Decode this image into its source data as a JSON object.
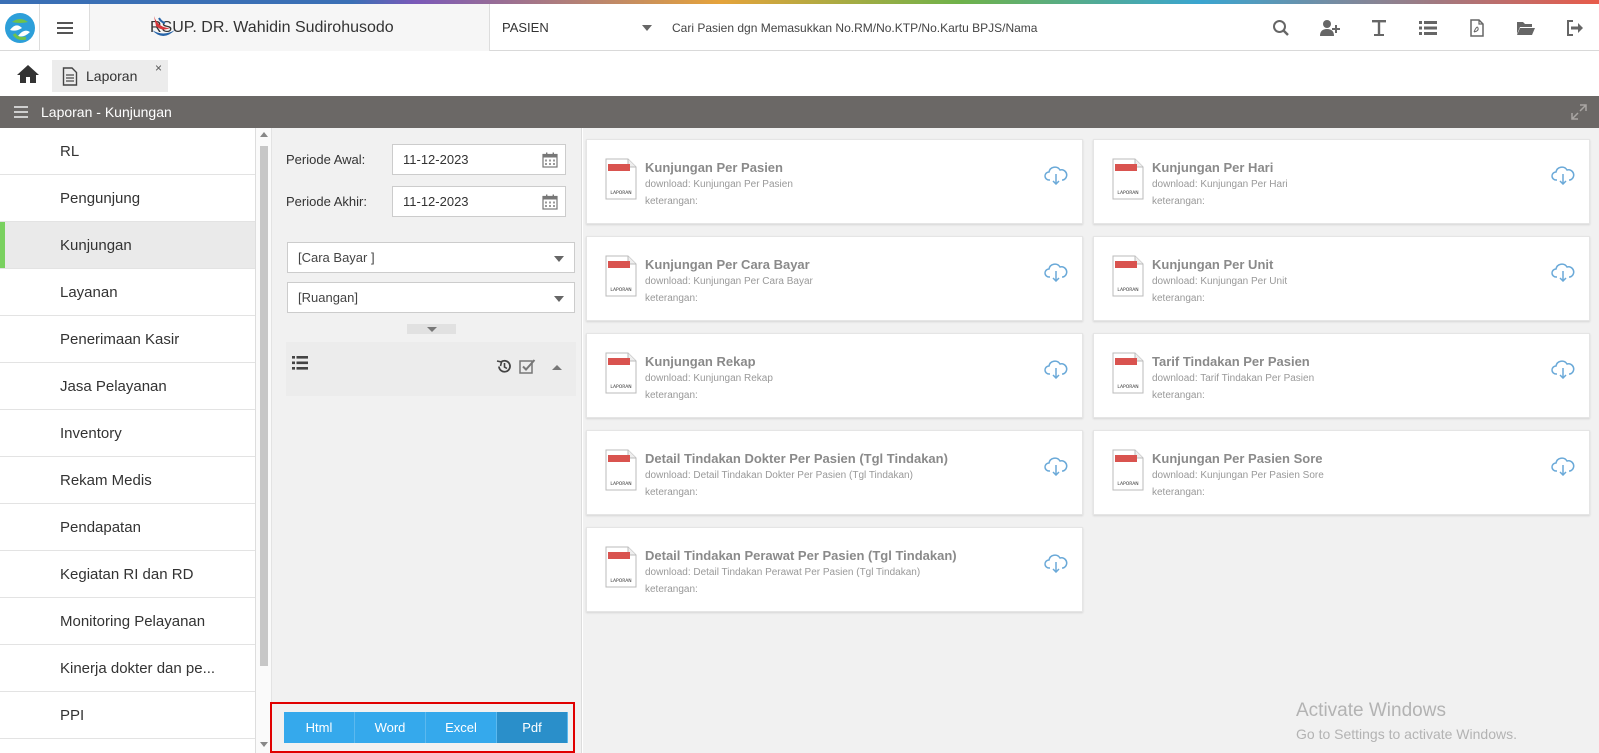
{
  "header": {
    "hospital_name": "RSUP. DR. Wahidin Sudirohusodo",
    "search_category": "PASIEN",
    "search_placeholder": "Cari Pasien dgn Memasukkan No.RM/No.KTP/No.Kartu BPJS/Nama",
    "icons": [
      "search-icon",
      "add-user-icon",
      "text-icon",
      "list-icon",
      "pdf-icon",
      "folder-open-icon",
      "logout-icon"
    ]
  },
  "tabs": [
    {
      "label": "Laporan",
      "close": "×"
    }
  ],
  "section": {
    "title": "Laporan - Kunjungan"
  },
  "sidebar": {
    "items": [
      {
        "label": "RL"
      },
      {
        "label": "Pengunjung"
      },
      {
        "label": "Kunjungan",
        "active": true
      },
      {
        "label": "Layanan"
      },
      {
        "label": "Penerimaan Kasir"
      },
      {
        "label": "Jasa Pelayanan"
      },
      {
        "label": "Inventory"
      },
      {
        "label": "Rekam Medis"
      },
      {
        "label": "Pendapatan"
      },
      {
        "label": "Kegiatan RI dan RD"
      },
      {
        "label": "Monitoring Pelayanan"
      },
      {
        "label": "Kinerja dokter dan pe..."
      },
      {
        "label": "PPI"
      }
    ]
  },
  "filters": {
    "periode_awal_label": "Periode Awal:",
    "periode_awal_value": "11-12-2023",
    "periode_akhir_label": "Periode Akhir:",
    "periode_akhir_value": "11-12-2023",
    "cara_bayar": "[Cara Bayar ]",
    "ruangan": "[Ruangan]"
  },
  "formats": [
    {
      "label": "Html"
    },
    {
      "label": "Word"
    },
    {
      "label": "Excel"
    },
    {
      "label": "Pdf",
      "active": true
    }
  ],
  "reports": [
    {
      "title": "Kunjungan Per Pasien",
      "download": "download: Kunjungan Per Pasien",
      "keterangan": "keterangan:"
    },
    {
      "title": "Kunjungan Per Hari",
      "download": "download: Kunjungan Per Hari",
      "keterangan": "keterangan:"
    },
    {
      "title": "Kunjungan Per Cara Bayar",
      "download": "download: Kunjungan Per Cara Bayar",
      "keterangan": "keterangan:"
    },
    {
      "title": "Kunjungan Per Unit",
      "download": "download: Kunjungan Per Unit",
      "keterangan": "keterangan:"
    },
    {
      "title": "Kunjungan Rekap",
      "download": "download: Kunjungan Rekap",
      "keterangan": "keterangan:"
    },
    {
      "title": "Tarif Tindakan Per Pasien",
      "download": "download: Tarif Tindakan Per Pasien",
      "keterangan": "keterangan:"
    },
    {
      "title": "Detail Tindakan Dokter Per Pasien (Tgl Tindakan)",
      "download": "download: Detail Tindakan Dokter Per Pasien (Tgl Tindakan)",
      "keterangan": "keterangan:"
    },
    {
      "title": "Kunjungan Per Pasien Sore",
      "download": "download: Kunjungan Per Pasien Sore",
      "keterangan": "keterangan:"
    },
    {
      "title": "Detail Tindakan Perawat Per Pasien (Tgl Tindakan)",
      "download": "download: Detail Tindakan Perawat Per Pasien (Tgl Tindakan)",
      "keterangan": "keterangan:"
    }
  ],
  "doc_icon_label": "LAPORAN",
  "watermark": {
    "line1": "Activate Windows",
    "line2": "Go to Settings to activate Windows."
  }
}
